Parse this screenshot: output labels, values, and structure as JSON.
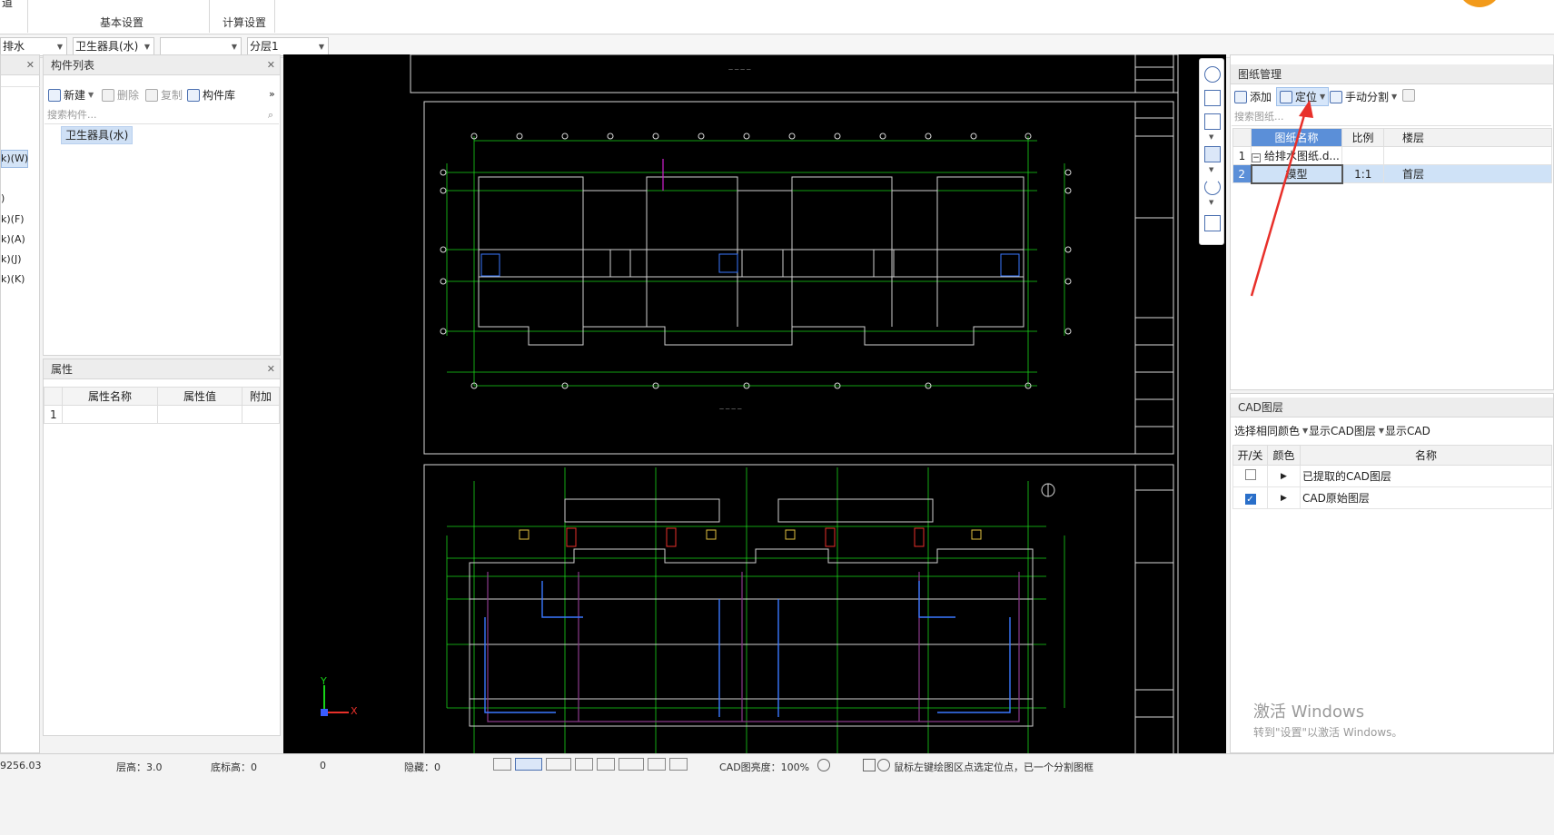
{
  "ribbon": {
    "partial_top_left": "道",
    "group_basic": "基本设置",
    "group_calc": "计算设置"
  },
  "selectors": {
    "discipline": "排水",
    "component_type": "卫生器具(水)",
    "empty_combo": "",
    "floor": "分层1"
  },
  "left_tree": {
    "items": [
      "k)(W)",
      ")",
      "k)(F)",
      "k)(A)",
      "k)(J)",
      "k)(K)"
    ]
  },
  "component_list": {
    "title": "构件列表",
    "new_label": "新建",
    "delete_label": "删除",
    "copy_label": "复制",
    "library_label": "构件库",
    "more": "»",
    "search_placeholder": "搜索构件...",
    "items": [
      "卫生器具(水)"
    ]
  },
  "properties": {
    "title": "属性",
    "columns": [
      "属性名称",
      "属性值",
      "附加"
    ],
    "rows": [
      {
        "index": "1",
        "name": "",
        "value": "",
        "extra": ""
      }
    ]
  },
  "drawing_mgmt": {
    "title": "图纸管理",
    "add_label": "添加",
    "locate_label": "定位",
    "split_label": "手动分割",
    "search_placeholder": "搜索图纸...",
    "columns": [
      "",
      "图纸名称",
      "比例",
      "楼层"
    ],
    "rows": [
      {
        "index": "1",
        "name": "给排水图纸.d...",
        "scale": "",
        "floor": "",
        "collapse": "−",
        "selected": false
      },
      {
        "index": "2",
        "name": "模型",
        "scale": "1:1",
        "floor": "首层",
        "collapse": "",
        "selected": true
      }
    ]
  },
  "cad_layers": {
    "title": "CAD图层",
    "select_same_color": "选择相同颜色",
    "show_cad_layer": "显示CAD图层",
    "show_cad_partial": "显示CAD",
    "columns": [
      "开/关",
      "颜色",
      "名称"
    ],
    "rows": [
      {
        "name": "已提取的CAD图层",
        "checked": false
      },
      {
        "name": "CAD原始图层",
        "checked": true
      }
    ]
  },
  "canvas": {
    "axis_x": "X",
    "axis_y": "Y",
    "bg_color": "#000000",
    "line_green": "#18d418",
    "line_white": "#d8d8d8"
  },
  "status": {
    "coord": "9256.03",
    "floor_height": "层高：3.0",
    "base_elev": "底标高：0",
    "zero": "0",
    "hidden": "隐藏：0",
    "cad_brightness": "CAD图亮度：100%",
    "hint": "鼠标左键绘图区点选定位点，已一个分割图框"
  },
  "watermark": {
    "line1": "激活 Windows",
    "line2": "转到\"设置\"以激活 Windows。"
  },
  "accent": {
    "blue": "#4a6fb0",
    "selected_row": "#cfe2f7",
    "header_blue": "#5b8fd8",
    "red_arrow": "#e8302a"
  }
}
